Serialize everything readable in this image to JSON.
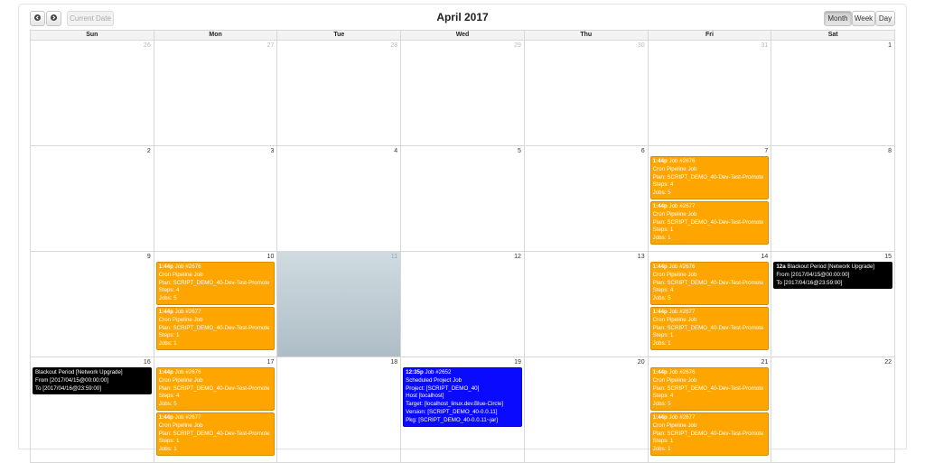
{
  "toolbar": {
    "prev_icon": "chevron-left-icon",
    "next_icon": "chevron-right-icon",
    "current_date_label": "Current Date",
    "title": "April 2017",
    "views": [
      "Month",
      "Week",
      "Day"
    ],
    "active_view": "Month"
  },
  "colors": {
    "pipeline": "#ffa500",
    "blackout": "#000000",
    "project": "#0a0aff",
    "today": "#b8c7ce"
  },
  "weekdays": [
    "Sun",
    "Mon",
    "Tue",
    "Wed",
    "Thu",
    "Fri",
    "Sat"
  ],
  "weeks": [
    [
      {
        "day": "26",
        "other": true,
        "events": []
      },
      {
        "day": "27",
        "other": true,
        "events": []
      },
      {
        "day": "28",
        "other": true,
        "events": []
      },
      {
        "day": "29",
        "other": true,
        "events": []
      },
      {
        "day": "30",
        "other": true,
        "events": []
      },
      {
        "day": "31",
        "other": true,
        "events": []
      },
      {
        "day": "1",
        "events": []
      }
    ],
    [
      {
        "day": "2",
        "events": []
      },
      {
        "day": "3",
        "events": []
      },
      {
        "day": "4",
        "events": []
      },
      {
        "day": "5",
        "events": []
      },
      {
        "day": "6",
        "events": []
      },
      {
        "day": "7",
        "events": [
          {
            "color": "orange",
            "time": "1:44p",
            "title": "Job #2676",
            "lines": [
              "Cron Pipeline Job",
              "Plan: SCRIPT_DEMO_40-Dev-Test-Promote",
              "Steps: 4",
              "Jobs: 5"
            ]
          },
          {
            "color": "orange",
            "time": "1:44p",
            "title": "Job #2677",
            "lines": [
              "Cron Pipeline Job",
              "Plan: SCRIPT_DEMO_40-Dev-Test-Promote",
              "Steps: 1",
              "Jobs: 1"
            ]
          }
        ]
      },
      {
        "day": "8",
        "events": []
      }
    ],
    [
      {
        "day": "9",
        "events": []
      },
      {
        "day": "10",
        "events": [
          {
            "color": "orange",
            "time": "1:44p",
            "title": "Job #2676",
            "lines": [
              "Cron Pipeline Job",
              "Plan: SCRIPT_DEMO_40-Dev-Test-Promote",
              "Steps: 4",
              "Jobs: 5"
            ]
          },
          {
            "color": "orange",
            "time": "1:44p",
            "title": "Job #2677",
            "lines": [
              "Cron Pipeline Job",
              "Plan: SCRIPT_DEMO_40-Dev-Test-Promote",
              "Steps: 1",
              "Jobs: 1"
            ]
          }
        ]
      },
      {
        "day": "11",
        "today": true,
        "events": []
      },
      {
        "day": "12",
        "events": []
      },
      {
        "day": "13",
        "events": []
      },
      {
        "day": "14",
        "events": [
          {
            "color": "orange",
            "time": "1:44p",
            "title": "Job #2676",
            "lines": [
              "Cron Pipeline Job",
              "Plan: SCRIPT_DEMO_40-Dev-Test-Promote",
              "Steps: 4",
              "Jobs: 5"
            ]
          },
          {
            "color": "orange",
            "time": "1:44p",
            "title": "Job #2677",
            "lines": [
              "Cron Pipeline Job",
              "Plan: SCRIPT_DEMO_40-Dev-Test-Promote",
              "Steps: 1",
              "Jobs: 1"
            ]
          }
        ]
      },
      {
        "day": "15",
        "events": [
          {
            "color": "black",
            "time": "12a",
            "title": "Blackout Period [Network Upgrade]",
            "lines": [
              "From [2017/04/15@00:00:00]",
              "To [2017/04/16@23:59:00]"
            ]
          }
        ]
      }
    ],
    [
      {
        "day": "16",
        "events": [
          {
            "color": "black",
            "time": "",
            "title": "Blackout Period [Network Upgrade]",
            "lines": [
              "From [2017/04/15@00:00:00]",
              "To [2017/04/16@23:59:00]"
            ]
          }
        ]
      },
      {
        "day": "17",
        "events": [
          {
            "color": "orange",
            "time": "1:44p",
            "title": "Job #2676",
            "lines": [
              "Cron Pipeline Job",
              "Plan: SCRIPT_DEMO_40-Dev-Test-Promote",
              "Steps: 4",
              "Jobs: 5"
            ]
          },
          {
            "color": "orange",
            "time": "1:44p",
            "title": "Job #2677",
            "lines": [
              "Cron Pipeline Job",
              "Plan: SCRIPT_DEMO_40-Dev-Test-Promote",
              "Steps: 1",
              "Jobs: 1"
            ]
          }
        ]
      },
      {
        "day": "18",
        "events": []
      },
      {
        "day": "19",
        "events": [
          {
            "color": "blue",
            "time": "12:35p",
            "title": "Job #2652",
            "lines": [
              "Scheduled Project Job",
              "Project: [SCRIPT_DEMO_40]",
              "Host [localhost]",
              "Target: [localhost_linux.dev.Blue-Circle]",
              "Version: [SCRIPT_DEMO_40-0.0.11]",
              "Pkg: [SCRIPT_DEMO_40-0.0.11~jar]"
            ]
          }
        ]
      },
      {
        "day": "20",
        "events": []
      },
      {
        "day": "21",
        "events": [
          {
            "color": "orange",
            "time": "1:44p",
            "title": "Job #2676",
            "lines": [
              "Cron Pipeline Job",
              "Plan: SCRIPT_DEMO_40-Dev-Test-Promote",
              "Steps: 4",
              "Jobs: 5"
            ]
          },
          {
            "color": "orange",
            "time": "1:44p",
            "title": "Job #2677",
            "lines": [
              "Cron Pipeline Job",
              "Plan: SCRIPT_DEMO_40-Dev-Test-Promote",
              "Steps: 1",
              "Jobs: 1"
            ]
          }
        ]
      },
      {
        "day": "22",
        "events": []
      }
    ]
  ]
}
